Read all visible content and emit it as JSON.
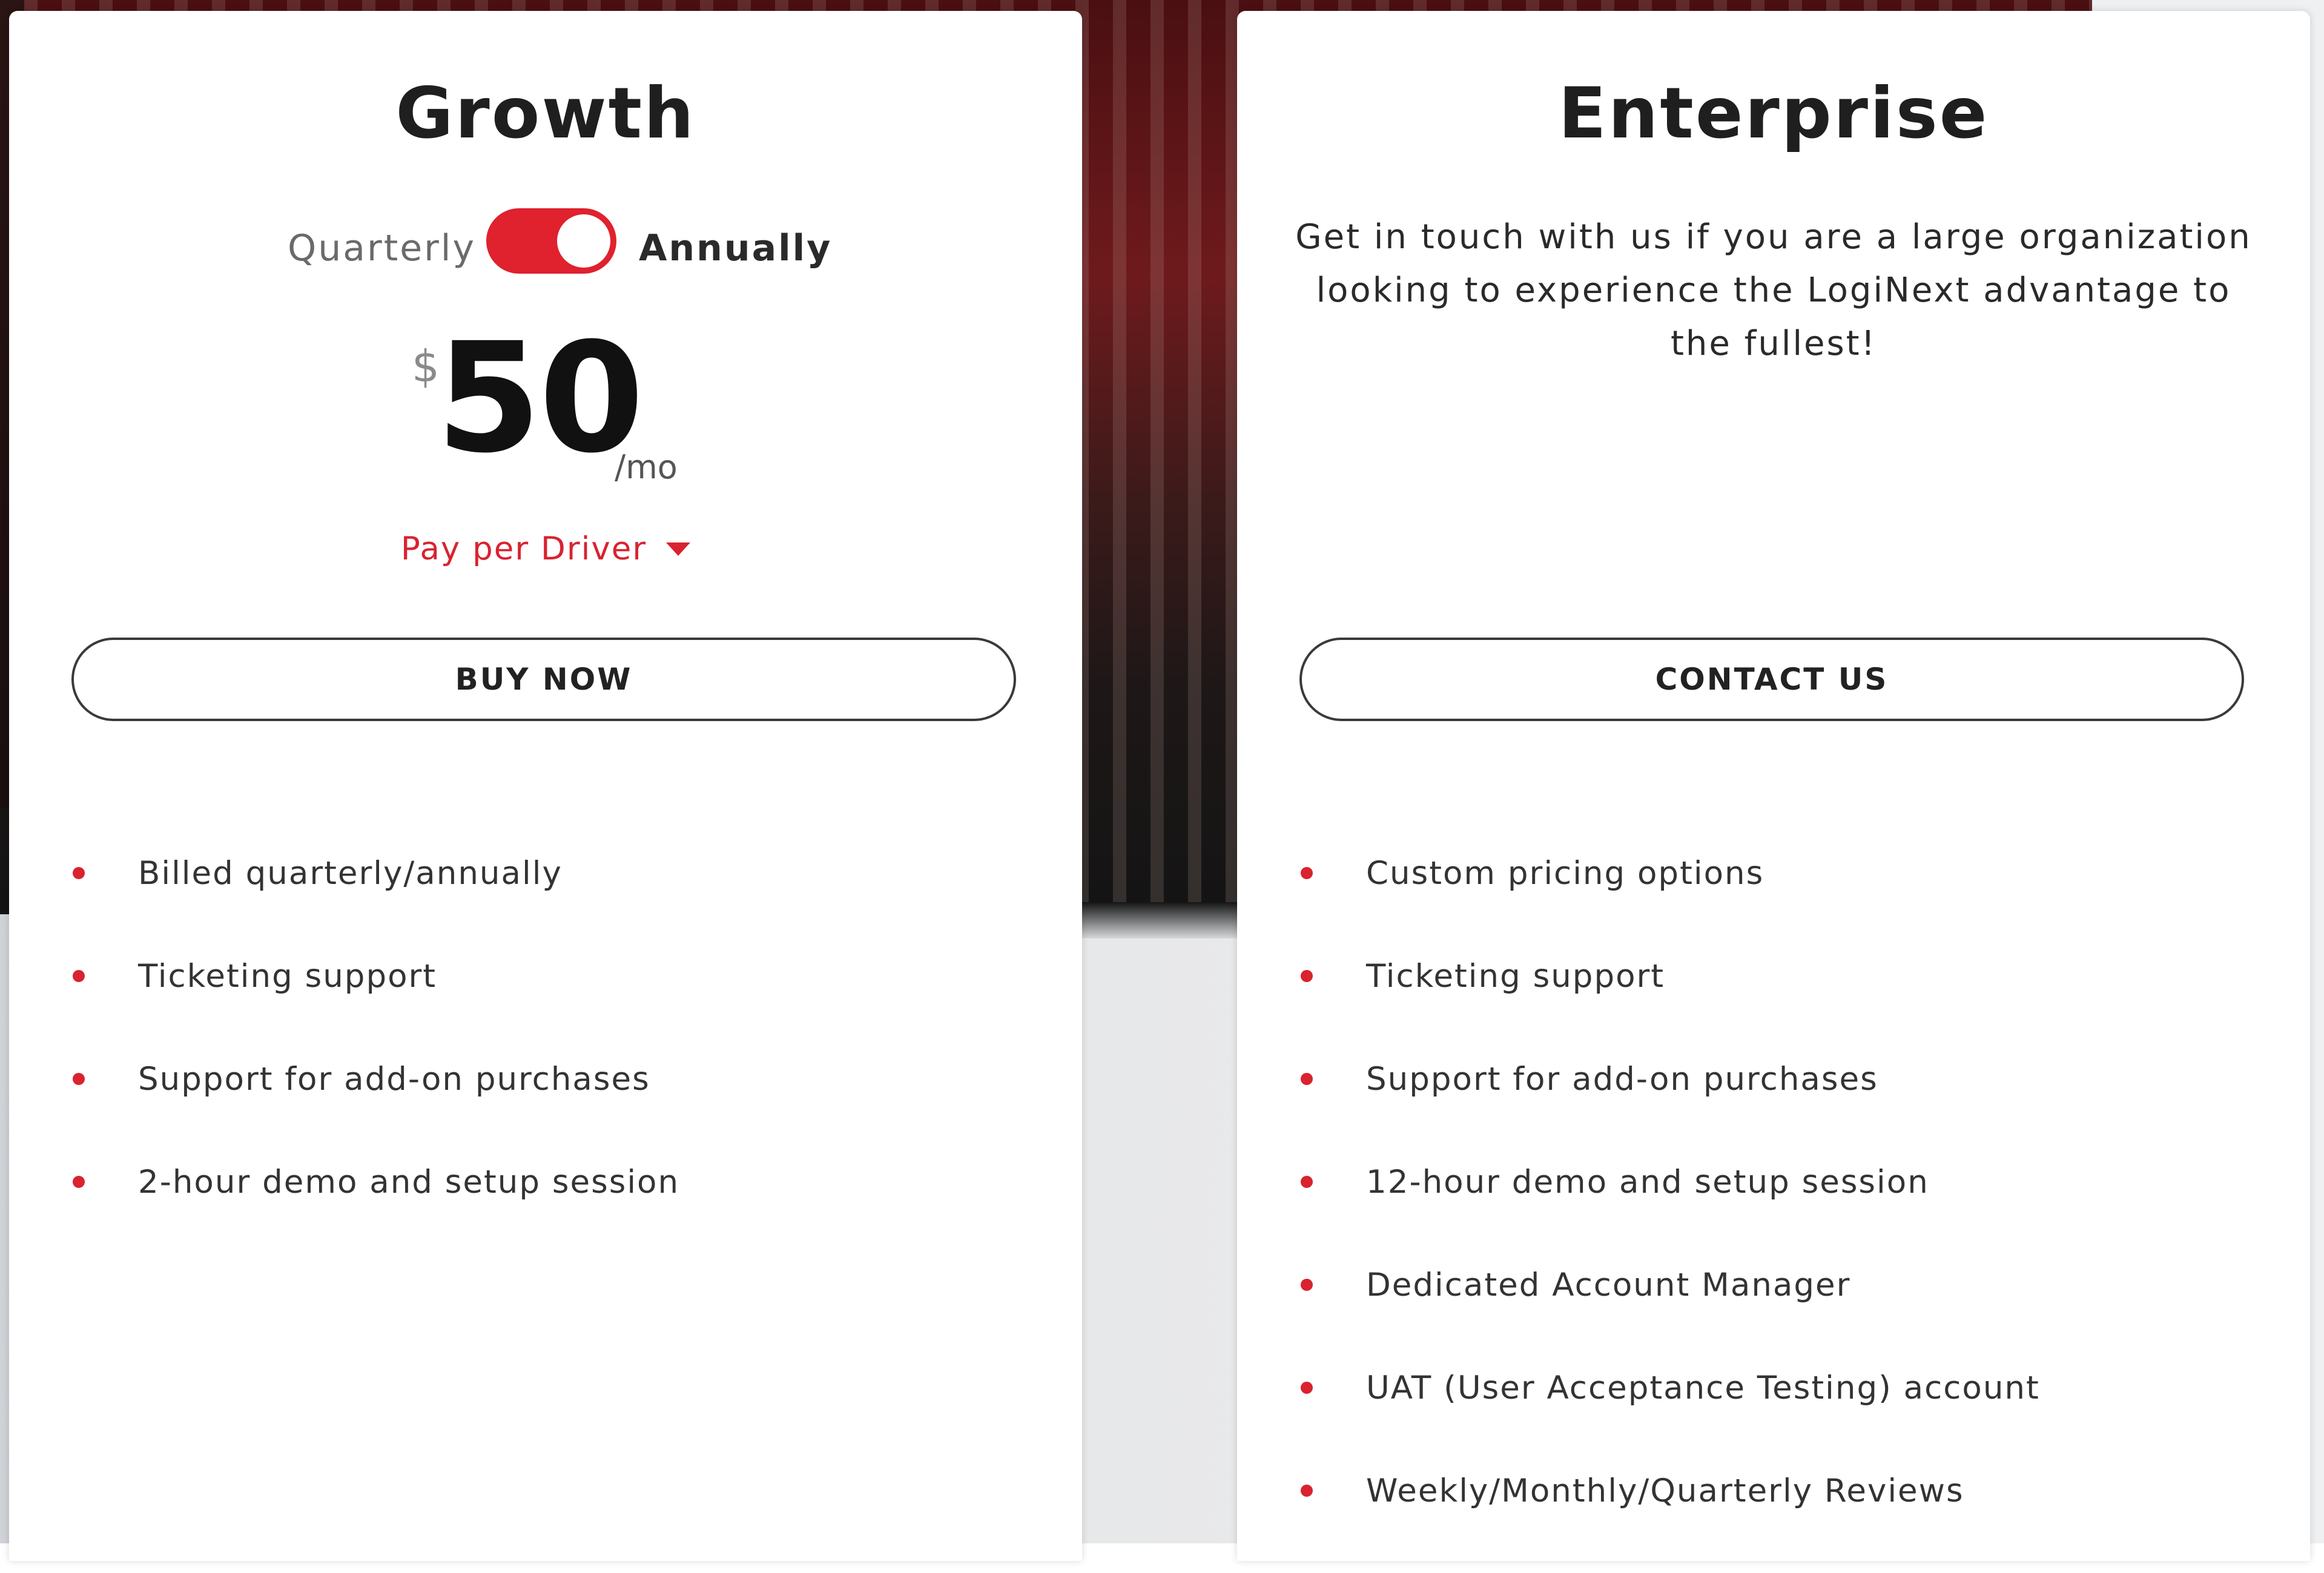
{
  "colors": {
    "accent": "#e0212e",
    "text_dark": "#1f1f1f",
    "text_muted": "#6a6a6a"
  },
  "growth": {
    "title": "Growth",
    "toggle": {
      "left_label": "Quarterly",
      "right_label": "Annually",
      "selected": "Annually"
    },
    "price": {
      "currency": "$",
      "amount": "50",
      "unit": "/mo"
    },
    "pricing_model": "Pay per Driver",
    "button_label": "BUY NOW",
    "features": [
      "Billed quarterly/annually",
      "Ticketing support",
      "Support for add-on purchases",
      "2-hour demo and setup session"
    ]
  },
  "enterprise": {
    "title": "Enterprise",
    "description": "Get in touch with us if you are a large organization looking to experience the LogiNext advantage to the fullest!",
    "button_label": "CONTACT US",
    "features": [
      "Custom pricing options",
      "Ticketing support",
      "Support for add-on purchases",
      "12-hour demo and setup session",
      "Dedicated Account Manager",
      "UAT (User Acceptance Testing) account",
      "Weekly/Monthly/Quarterly Reviews"
    ]
  }
}
